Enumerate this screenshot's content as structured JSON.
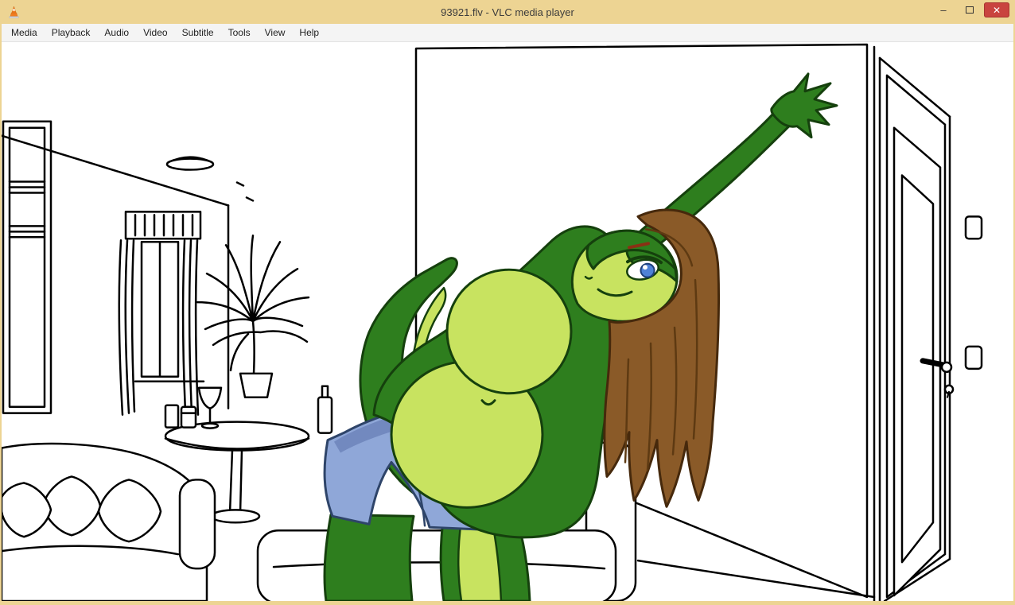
{
  "window": {
    "title": "93921.flv - VLC media player",
    "controls": {
      "minimize": "–",
      "close": "✕"
    }
  },
  "menu": {
    "items": [
      "Media",
      "Playback",
      "Audio",
      "Video",
      "Subtitle",
      "Tools",
      "View",
      "Help"
    ]
  },
  "theme": {
    "titlebar_bg": "#edd493",
    "close_button_red": "#c9443f",
    "menu_bg": "#f4f4f4",
    "video_bg": "#ffffff"
  },
  "video_scene": {
    "colors": {
      "body_dark_green": "#2e7e1e",
      "body_light_green": "#c8e360",
      "hair_brown": "#8a5a28",
      "shorts_blue": "#8fa7d8",
      "line_art": "#000000"
    }
  }
}
